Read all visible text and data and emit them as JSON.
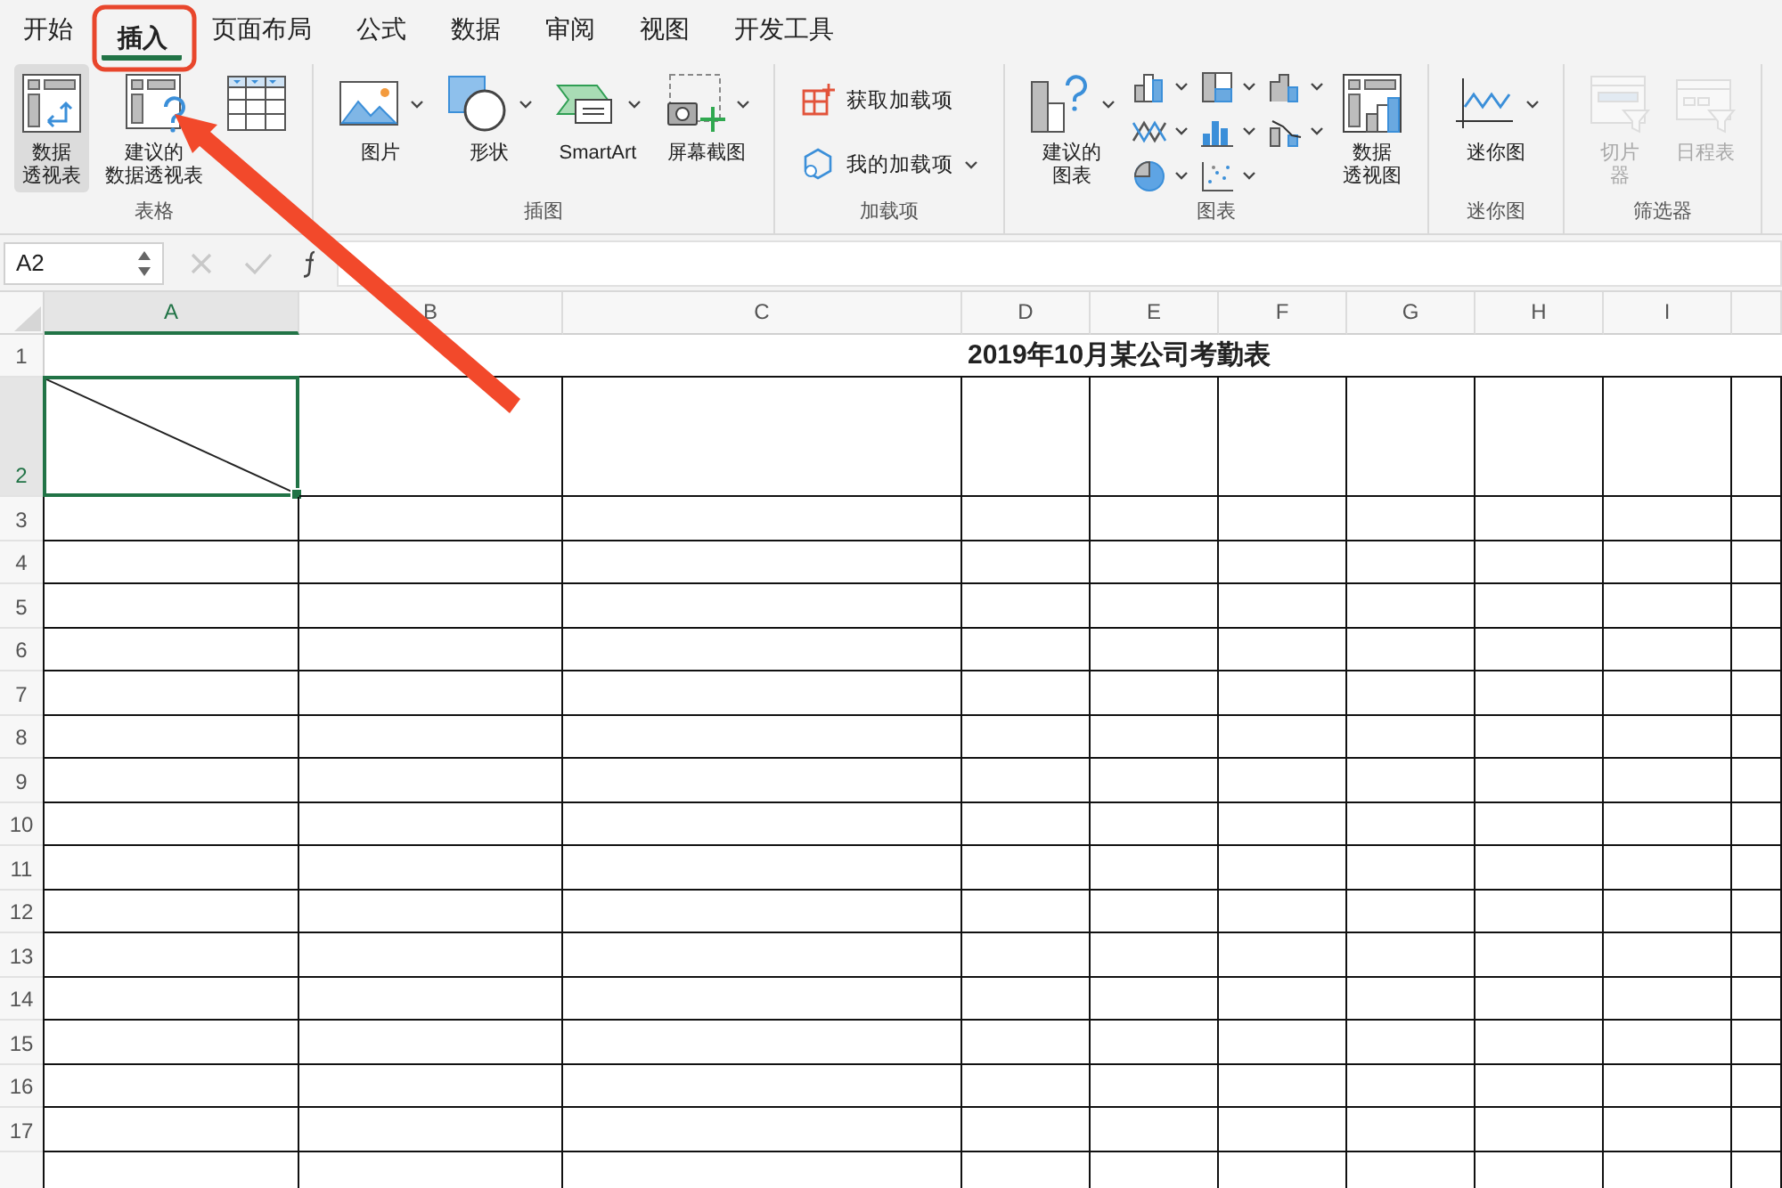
{
  "tabs": [
    {
      "label": "开始",
      "selected": false
    },
    {
      "label": "插入",
      "selected": true
    },
    {
      "label": "页面布局",
      "selected": false
    },
    {
      "label": "公式",
      "selected": false
    },
    {
      "label": "数据",
      "selected": false
    },
    {
      "label": "审阅",
      "selected": false
    },
    {
      "label": "视图",
      "selected": false
    },
    {
      "label": "开发工具",
      "selected": false
    }
  ],
  "ribbon": {
    "groups": [
      {
        "label": "表格",
        "items": [
          {
            "kind": "large",
            "label": [
              "数据",
              "透视表"
            ],
            "pressed": true,
            "disabled": false,
            "dropdown": false
          },
          {
            "kind": "large",
            "label": [
              "建议的",
              "数据透视表"
            ],
            "pressed": false,
            "disabled": false,
            "dropdown": false
          },
          {
            "kind": "large",
            "pressed": false,
            "disabled": false,
            "dropdown": false
          }
        ]
      },
      {
        "label": "插图",
        "items": [
          {
            "kind": "large",
            "label": [
              "图片"
            ],
            "pressed": false,
            "disabled": false,
            "dropdown": true
          },
          {
            "kind": "large",
            "label": [
              "形状"
            ],
            "pressed": false,
            "disabled": false,
            "dropdown": true
          },
          {
            "kind": "large",
            "label": [
              "SmartArt"
            ],
            "pressed": false,
            "disabled": false,
            "dropdown": true
          },
          {
            "kind": "large",
            "label": [
              "屏幕截图"
            ],
            "pressed": false,
            "disabled": false,
            "dropdown": true
          }
        ]
      },
      {
        "label": "加载项",
        "items": [
          {
            "kind": "small",
            "label": "获取加载项",
            "pressed": false,
            "disabled": false,
            "dropdown": false
          },
          {
            "kind": "small",
            "label": "我的加载项",
            "pressed": false,
            "disabled": false,
            "dropdown": true
          }
        ]
      },
      {
        "label": "图表",
        "items": [
          {
            "kind": "large",
            "label": [
              "建议的",
              "图表"
            ],
            "pressed": false,
            "disabled": false,
            "dropdown": true
          },
          {
            "kind": "icon-menu",
            "pressed": false,
            "disabled": false,
            "dropdown": true
          },
          {
            "kind": "icon-menu",
            "pressed": false,
            "disabled": false,
            "dropdown": true
          },
          {
            "kind": "icon-menu",
            "pressed": false,
            "disabled": false,
            "dropdown": true
          },
          {
            "kind": "icon-menu",
            "pressed": false,
            "disabled": false,
            "dropdown": true
          },
          {
            "kind": "icon-menu",
            "pressed": false,
            "disabled": false,
            "dropdown": true
          },
          {
            "kind": "icon-menu",
            "pressed": false,
            "disabled": false,
            "dropdown": true
          },
          {
            "kind": "icon-menu",
            "pressed": false,
            "disabled": false,
            "dropdown": true
          },
          {
            "kind": "icon-menu",
            "pressed": false,
            "disabled": false,
            "dropdown": true
          },
          {
            "kind": "large",
            "label": [
              "数据",
              "透视图"
            ],
            "pressed": false,
            "disabled": false,
            "dropdown": false
          }
        ]
      },
      {
        "label": "迷你图",
        "items": [
          {
            "kind": "large",
            "label": [
              "迷你图"
            ],
            "pressed": false,
            "disabled": false,
            "dropdown": true
          }
        ]
      },
      {
        "label": "筛选器",
        "items": [
          {
            "kind": "large",
            "label": [
              "切片",
              "器"
            ],
            "pressed": false,
            "disabled": true,
            "dropdown": false
          },
          {
            "kind": "large",
            "label": [
              "日程表"
            ],
            "pressed": false,
            "disabled": true,
            "dropdown": false
          }
        ]
      }
    ]
  },
  "name_box": {
    "value": "A2"
  },
  "sheet": {
    "title": "2019年10月某公司考勤表",
    "columns": [
      {
        "label": "A",
        "selected": true
      },
      {
        "label": "B",
        "selected": false
      },
      {
        "label": "C",
        "selected": false
      },
      {
        "label": "D",
        "selected": false
      },
      {
        "label": "E",
        "selected": false
      },
      {
        "label": "F",
        "selected": false
      },
      {
        "label": "G",
        "selected": false
      },
      {
        "label": "H",
        "selected": false
      },
      {
        "label": "I",
        "selected": false
      }
    ],
    "rows": [
      {
        "label": "1",
        "selected": false
      },
      {
        "label": "2",
        "selected": true
      },
      {
        "label": "3",
        "selected": false
      },
      {
        "label": "4",
        "selected": false
      },
      {
        "label": "5",
        "selected": false
      },
      {
        "label": "6",
        "selected": false
      },
      {
        "label": "7",
        "selected": false
      },
      {
        "label": "8",
        "selected": false
      },
      {
        "label": "9",
        "selected": false
      },
      {
        "label": "10",
        "selected": false
      },
      {
        "label": "11",
        "selected": false
      },
      {
        "label": "12",
        "selected": false
      },
      {
        "label": "13",
        "selected": false
      },
      {
        "label": "14",
        "selected": false
      },
      {
        "label": "15",
        "selected": false
      },
      {
        "label": "16",
        "selected": false
      },
      {
        "label": "17",
        "selected": false
      }
    ]
  }
}
